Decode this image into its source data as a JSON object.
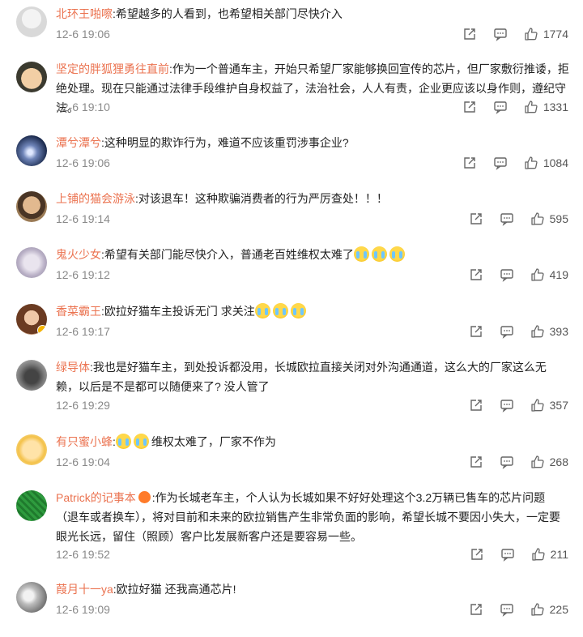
{
  "comments": [
    {
      "user": "北环王啪嚓",
      "text": ":希望越多的人看到，也希望相关部门尽快介入",
      "time": "12-6 19:06",
      "likes": "1774"
    },
    {
      "user": "坚定的胖狐狸勇往直前",
      "text": ":作为一个普通车主，开始只希望厂家能够换回宣传的芯片，但厂家敷衍推诿，拒绝处理。现在只能通过法律手段维护自身权益了，法治社会，人人有责，企业更应该以身作则，遵纪守法。",
      "time": "12-6 19:10",
      "likes": "1331"
    },
    {
      "user": "潭兮潭兮",
      "text": ":这种明显的欺诈行为，难道不应该重罚涉事企业?",
      "time": "12-6 19:06",
      "likes": "1084"
    },
    {
      "user": "上铺的猫会游泳",
      "text": ":对该退车！这种欺骗消费者的行为严厉查处！！！",
      "time": "12-6 19:14",
      "likes": "595"
    },
    {
      "user": "鬼火少女",
      "text": ":希望有关部门能尽快介入，普通老百姓维权太难了",
      "time": "12-6 19:12",
      "likes": "419"
    },
    {
      "user": "香菜霸王",
      "text": ":欧拉好猫车主投诉无门 求关注",
      "time": "12-6 19:17",
      "likes": "393"
    },
    {
      "user": "绿导体",
      "text": ":我也是好猫车主，到处投诉都没用，长城欧拉直接关闭对外沟通通道，这么大的厂家这么无赖，以后是不是都可以随便来了? 没人管了",
      "time": "12-6 19:29",
      "likes": "357"
    },
    {
      "user": "有只蜜小蜂",
      "text": "维权太难了，厂家不作为",
      "time": "12-6 19:04",
      "likes": "268"
    },
    {
      "user": "Patrick的记事本",
      "text": ":作为长城老车主，个人认为长城如果不好好处理这个3.2万辆已售车的芯片问题（退车或者换车），将对目前和未来的欧拉销售产生非常负面的影响，希望长城不要因小失大，一定要眼光长远，留住（照顾）客户比发展新客户还是要容易一些。",
      "time": "12-6 19:52",
      "likes": "211"
    },
    {
      "user": "葭月十一ya",
      "text": ":欧拉好猫 还我高通芯片!",
      "time": "12-6 19:09",
      "likes": "225"
    }
  ],
  "colors": {
    "username": "#eb7350",
    "timestamp": "#8a8a8a",
    "text": "#222222"
  },
  "icons": {
    "share": "share-icon",
    "reply": "comment-icon",
    "like": "thumbs-up-icon"
  }
}
